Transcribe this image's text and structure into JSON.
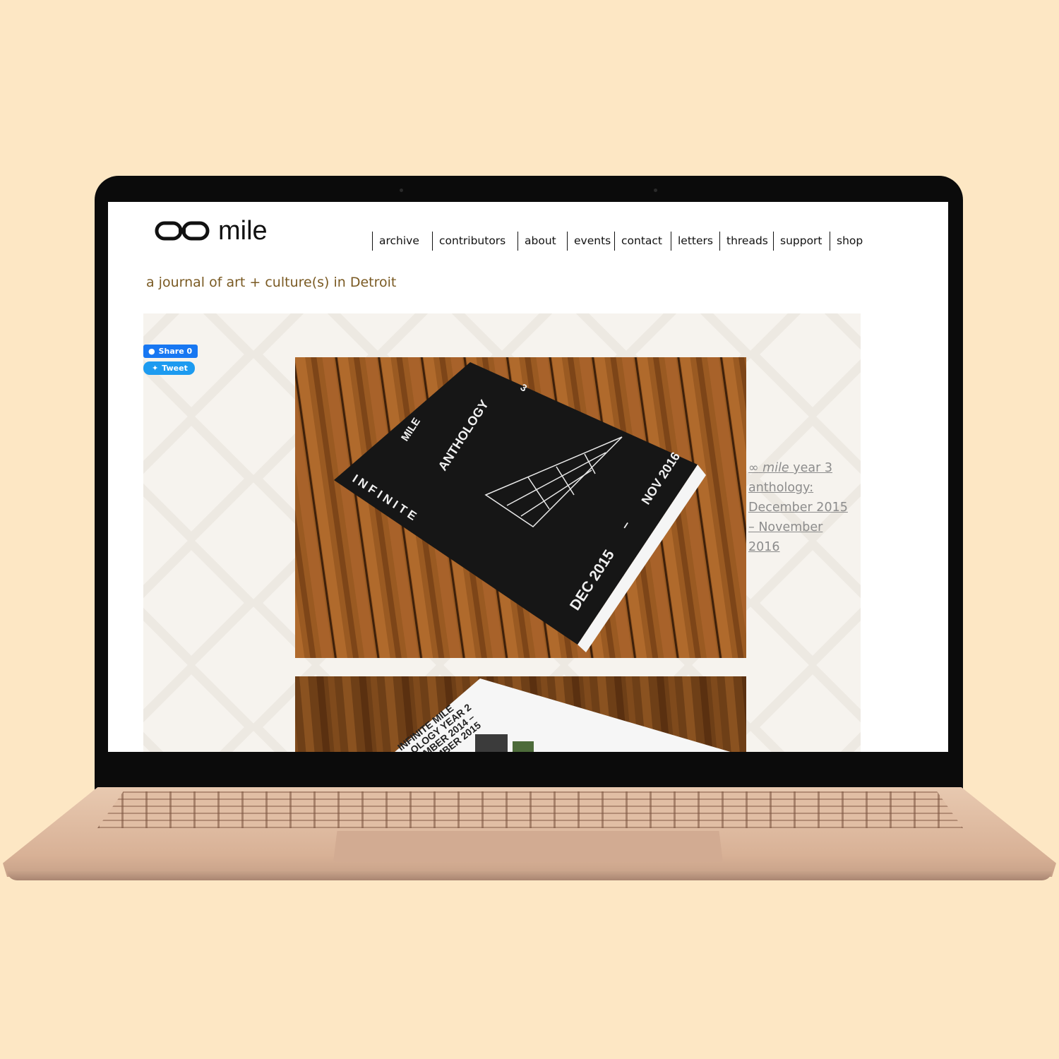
{
  "site": {
    "logo_symbol": "∞",
    "logo_text": "mile",
    "tagline": "a journal of art + culture(s) in Detroit"
  },
  "nav": {
    "items": [
      "archive",
      "contributors",
      "about",
      "events",
      "contact",
      "letters",
      "threads",
      "support",
      "shop"
    ]
  },
  "social": {
    "share_label": "Share 0",
    "tweet_label": "Tweet",
    "share_icon": "facebook-icon",
    "tweet_icon": "twitter-bird-icon"
  },
  "feature": {
    "book_cover": {
      "series": "MILE",
      "title": "ANTHOLOGY",
      "volume": "3",
      "vertical": "I N F I N I T E",
      "date_start": "DEC 2015",
      "date_end": "NOV 2016",
      "dash": "–"
    },
    "second_book_lines": [
      "INFINITE MILE",
      "OLOGY YEAR 2",
      "MBER 2014 –",
      "MBER 2015"
    ],
    "caption": {
      "prefix": "∞",
      "italic": "mile",
      "rest": "year 3 anthology: December 2015 – November 2016"
    }
  },
  "colors": {
    "background": "#fde7c4",
    "tagline": "#7a5a23",
    "caption": "#8c8c8c",
    "facebook": "#1877f2",
    "twitter": "#1d9bf0"
  }
}
